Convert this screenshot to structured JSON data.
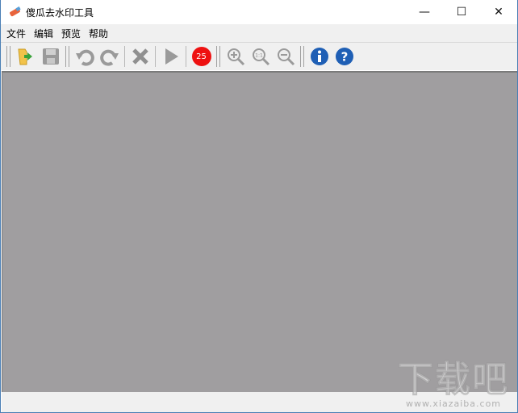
{
  "window": {
    "title": "傻瓜去水印工具",
    "minimize": "—",
    "maximize": "☐",
    "close": "✕"
  },
  "menu": [
    "文件",
    "编辑",
    "预览",
    "帮助"
  ],
  "toolbar": {
    "badge_value": "25",
    "zoom_reset_label": "1:1"
  },
  "watermark": {
    "logo": "下载吧",
    "url": "www.xiazaiba.com"
  },
  "colors": {
    "canvas": "#a09ea0",
    "badge": "#ee1111",
    "info": "#1f5fb5"
  }
}
